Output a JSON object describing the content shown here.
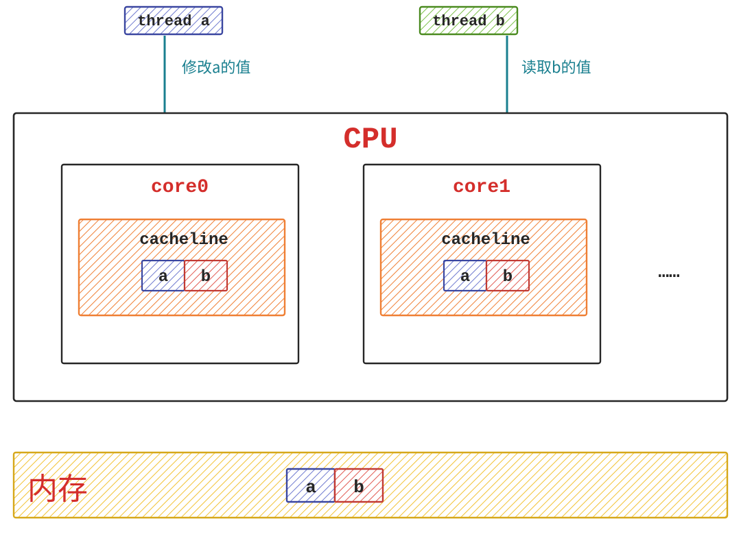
{
  "threads": {
    "a": {
      "label": "thread a"
    },
    "b": {
      "label": "thread b"
    }
  },
  "arrows": {
    "a": {
      "label": "修改a的值"
    },
    "b": {
      "label": "读取b的值"
    }
  },
  "cpu": {
    "title": "CPU",
    "cores": [
      {
        "label": "core0",
        "cacheline_label": "cacheline",
        "cells": [
          "a",
          "b"
        ]
      },
      {
        "label": "core1",
        "cacheline_label": "cacheline",
        "cells": [
          "a",
          "b"
        ]
      }
    ],
    "ellipsis": "……"
  },
  "memory": {
    "label": "内存",
    "cells": [
      "a",
      "b"
    ]
  },
  "colors": {
    "red": "#d42e2b",
    "black": "#262626",
    "teal": "#197f8f",
    "orange": "#ef7f34",
    "orange_fill": "#ef7f34",
    "yellow": "#f2c233",
    "yellow_fill": "#f2c233",
    "blue_fill": "#6f7acf",
    "green_fill": "#7cc24a",
    "redcell": "#e15a52",
    "redcell_fill": "#e15a52"
  }
}
